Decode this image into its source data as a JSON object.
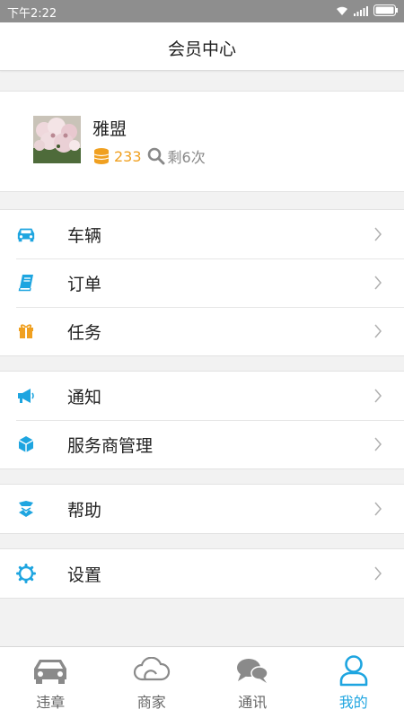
{
  "status_bar": {
    "time": "下午2:22"
  },
  "header": {
    "title": "会员中心"
  },
  "profile": {
    "name": "雅盟",
    "coins": "233",
    "remaining": "剩6次"
  },
  "menu_groups": [
    {
      "items": [
        {
          "label": "车辆",
          "icon": "car-icon"
        },
        {
          "label": "订单",
          "icon": "book-icon"
        },
        {
          "label": "任务",
          "icon": "gift-icon"
        }
      ]
    },
    {
      "items": [
        {
          "label": "通知",
          "icon": "megaphone-icon"
        },
        {
          "label": "服务商管理",
          "icon": "cube-icon"
        }
      ]
    },
    {
      "items": [
        {
          "label": "帮助",
          "icon": "help-icon"
        }
      ]
    },
    {
      "items": [
        {
          "label": "设置",
          "icon": "gear-icon"
        }
      ]
    }
  ],
  "tabs": [
    {
      "label": "违章",
      "icon": "car-icon"
    },
    {
      "label": "商家",
      "icon": "cloud-icon"
    },
    {
      "label": "通讯",
      "icon": "chat-icon"
    },
    {
      "label": "我的",
      "icon": "user-icon",
      "active": true
    }
  ],
  "colors": {
    "accent": "#1ea5e0",
    "coin": "#f0a020",
    "status_bar": "#8e8e8e"
  }
}
